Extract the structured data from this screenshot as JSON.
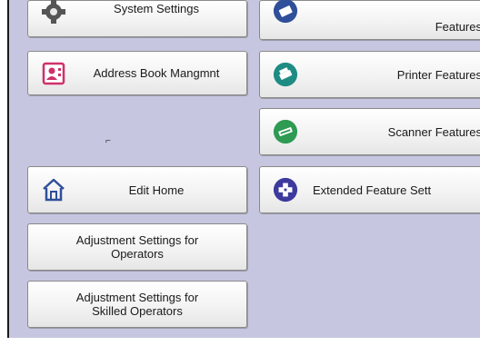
{
  "left_column": {
    "system_settings": "System Settings",
    "address_book": "Address Book Mangmnt",
    "edit_home": "Edit Home",
    "adjust_operators_line1": "Adjustment Settings for",
    "adjust_operators_line2": "Operators",
    "adjust_skilled_line1": "Adjustment Settings for",
    "adjust_skilled_line2": "Skilled Operators"
  },
  "right_column": {
    "features": "Features",
    "printer_features": "Printer Features",
    "scanner_features": "Scanner Features",
    "extended_feature": "Extended Feature Sett"
  },
  "icons": {
    "gear": "gear-icon",
    "address_book": "address-book-icon",
    "home": "home-icon",
    "copier": "copier-icon",
    "printer": "printer-icon",
    "scanner": "scanner-icon",
    "extended": "extended-feature-icon"
  },
  "colors": {
    "background": "#c6c6e0",
    "accent_blue": "#2f4f9a",
    "accent_green": "#2e9a52",
    "accent_teal": "#1f8c84",
    "accent_purple": "#3d3a9e",
    "address_pink": "#d0306a"
  }
}
